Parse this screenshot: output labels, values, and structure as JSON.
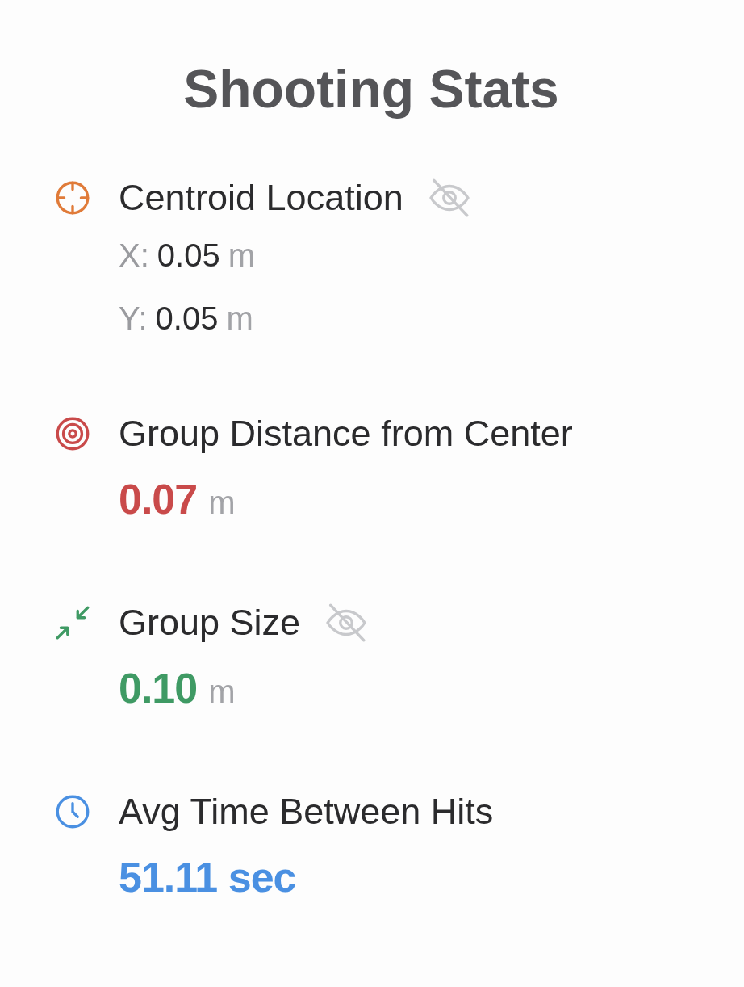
{
  "title": "Shooting Stats",
  "stats": [
    {
      "kind": "centroid",
      "color": "#e07b39",
      "label": "Centroid Location",
      "hidden": true,
      "coordinates": [
        {
          "axis": "X:",
          "value": "0.05",
          "unit": "m"
        },
        {
          "axis": "Y:",
          "value": "0.05",
          "unit": "m"
        }
      ]
    },
    {
      "kind": "distance",
      "color": "#c94a4a",
      "label": "Group Distance from Center",
      "hidden": false,
      "value": "0.07",
      "unit": "m"
    },
    {
      "kind": "size",
      "color": "#3f9a64",
      "label": "Group Size",
      "hidden": true,
      "value": "0.10",
      "unit": "m"
    },
    {
      "kind": "time",
      "color": "#4a90e2",
      "label": "Avg Time Between Hits",
      "hidden": false,
      "value": "51.11 sec"
    }
  ]
}
